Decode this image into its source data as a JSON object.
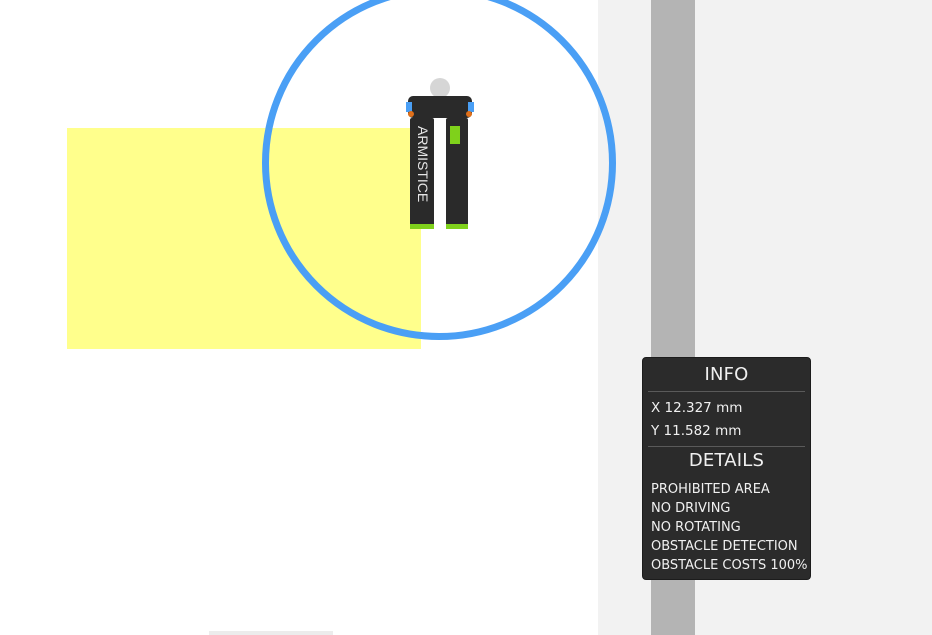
{
  "robot": {
    "label": "ARMISTICE",
    "icon": "robot-top-view-icon"
  },
  "colors": {
    "prohibited_area": "#ffff8c",
    "selection_ring": "#4a9ff5",
    "corridor": "#b4b4b4",
    "panel_background": "#2b2b2b",
    "robot_body": "#2a2a2a",
    "robot_accent": "#7fd11b"
  },
  "info_panel": {
    "info_title": "INFO",
    "x_readout": "X 12.327 mm",
    "y_readout": "Y 11.582 mm",
    "details_title": "DETAILS",
    "details": [
      "PROHIBITED AREA",
      "NO DRIVING",
      "NO ROTATING",
      "OBSTACLE DETECTION",
      "OBSTACLE COSTS 100%"
    ]
  }
}
